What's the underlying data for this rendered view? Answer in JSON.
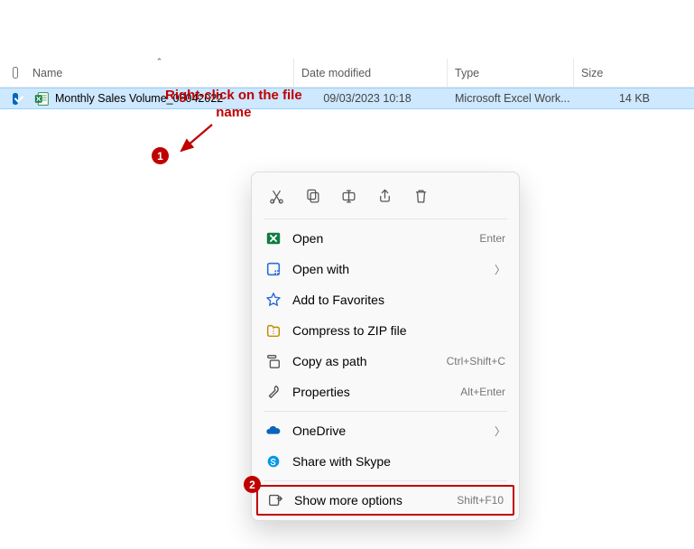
{
  "annotation": {
    "line1": "Right-click on the file",
    "line2": "name"
  },
  "columns": {
    "name": "Name",
    "date": "Date modified",
    "type": "Type",
    "size": "Size"
  },
  "file": {
    "name": "Monthly Sales Volume_06042022",
    "date": "09/03/2023 10:18",
    "type": "Microsoft Excel Work...",
    "size": "14 KB"
  },
  "badges": {
    "one": "1",
    "two": "2"
  },
  "ctx": {
    "open": "Open",
    "open_sc": "Enter",
    "openwith": "Open with",
    "fav": "Add to Favorites",
    "zip": "Compress to ZIP file",
    "copy": "Copy as path",
    "copy_sc": "Ctrl+Shift+C",
    "props": "Properties",
    "props_sc": "Alt+Enter",
    "onedrive": "OneDrive",
    "skype": "Share with Skype",
    "more": "Show more options",
    "more_sc": "Shift+F10"
  }
}
